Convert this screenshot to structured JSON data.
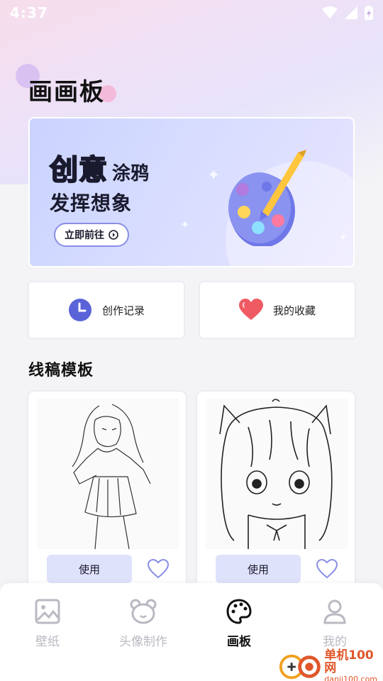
{
  "status_bar": {
    "time": "4:37"
  },
  "page": {
    "title": "画画板"
  },
  "banner": {
    "headline_big": "创意",
    "headline_small": "涂鸦",
    "headline_line2": "发挥想象",
    "button_label": "立即前往"
  },
  "quick_actions": [
    {
      "label": "创作记录",
      "icon": "clock-icon"
    },
    {
      "label": "我的收藏",
      "icon": "heart-icon"
    }
  ],
  "templates": {
    "section_title": "线稿模板",
    "items": [
      {
        "use_label": "使用"
      },
      {
        "use_label": "使用"
      }
    ]
  },
  "tabbar": {
    "items": [
      {
        "label": "壁纸",
        "icon": "image-icon"
      },
      {
        "label": "头像制作",
        "icon": "bear-icon"
      },
      {
        "label": "画板",
        "icon": "palette-icon"
      },
      {
        "label": "我的",
        "icon": "person-icon"
      }
    ],
    "active_index": 2
  },
  "watermark": {
    "text": "单机100网",
    "url": "danji100.com"
  },
  "colors": {
    "accent": "#5a6df0",
    "use_button_bg": "#dfe2fb",
    "heart": "#ef5a63",
    "clock": "#5b63d8",
    "inactive_tab": "#b9b9c2"
  }
}
